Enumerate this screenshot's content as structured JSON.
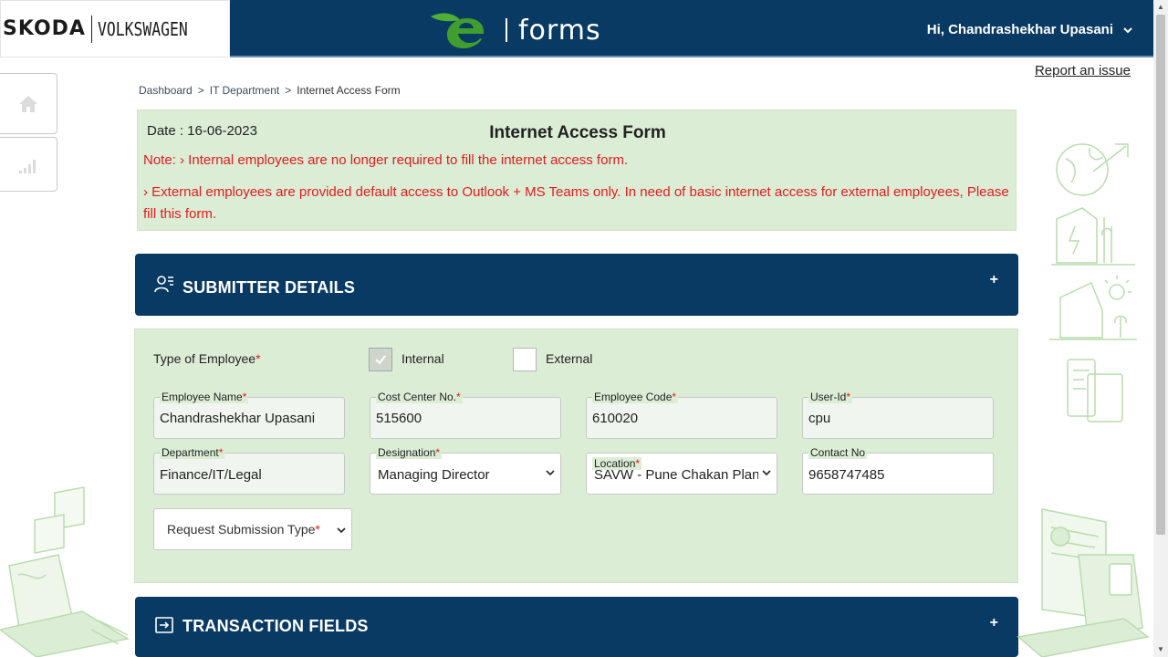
{
  "header": {
    "logo_brand_left": "SKODA",
    "logo_brand_right": "VOLKSWAGEN",
    "app_name": "forms",
    "user_greeting": "Hi, Chandrashekhar Upasani"
  },
  "report_link": "Report an issue",
  "breadcrumb": [
    "Dashboard",
    "IT Department",
    "Internet Access Form"
  ],
  "breadcrumb_sep": ">",
  "info": {
    "date": "Date : 16-06-2023",
    "title": "Internet Access Form",
    "note1": "Note: › Internal employees are no longer required to fill the internet access form.",
    "note2": "› External employees are provided default access to Outlook + MS Teams only. In need of basic internet access for external employees, Please fill this form."
  },
  "sections": {
    "submitter": {
      "label": "SUBMITTER DETAILS",
      "toggle": "+"
    },
    "transaction": {
      "label": "TRANSACTION FIELDS",
      "toggle": "+"
    }
  },
  "form": {
    "type_label": "Type of Employee",
    "required_mark": "*",
    "internal_label": "Internal",
    "internal_checked": true,
    "external_label": "External",
    "external_checked": false,
    "fields": {
      "employee_name": {
        "label": "Employee Name",
        "value": "Chandrashekhar Upasani"
      },
      "cost_center": {
        "label": "Cost Center No.",
        "value": "515600"
      },
      "employee_code": {
        "label": "Employee Code",
        "value": "610020"
      },
      "user_id": {
        "label": "User-Id",
        "value": "cpu"
      },
      "department": {
        "label": "Department",
        "value": "Finance/IT/Legal"
      },
      "designation": {
        "label": "Designation",
        "value": "Managing Director"
      },
      "location": {
        "label": "Location",
        "value": "SAVW - Pune Chakan Plant"
      },
      "contact_no": {
        "label": "Contact No",
        "value": "9658747485"
      }
    },
    "request_type": {
      "placeholder": "Request Submission Type"
    }
  },
  "colors": {
    "navy": "#093a63",
    "panel_green": "#dcedd6",
    "note_red": "#e31b1b",
    "brand_green": "#3f9e2e"
  }
}
